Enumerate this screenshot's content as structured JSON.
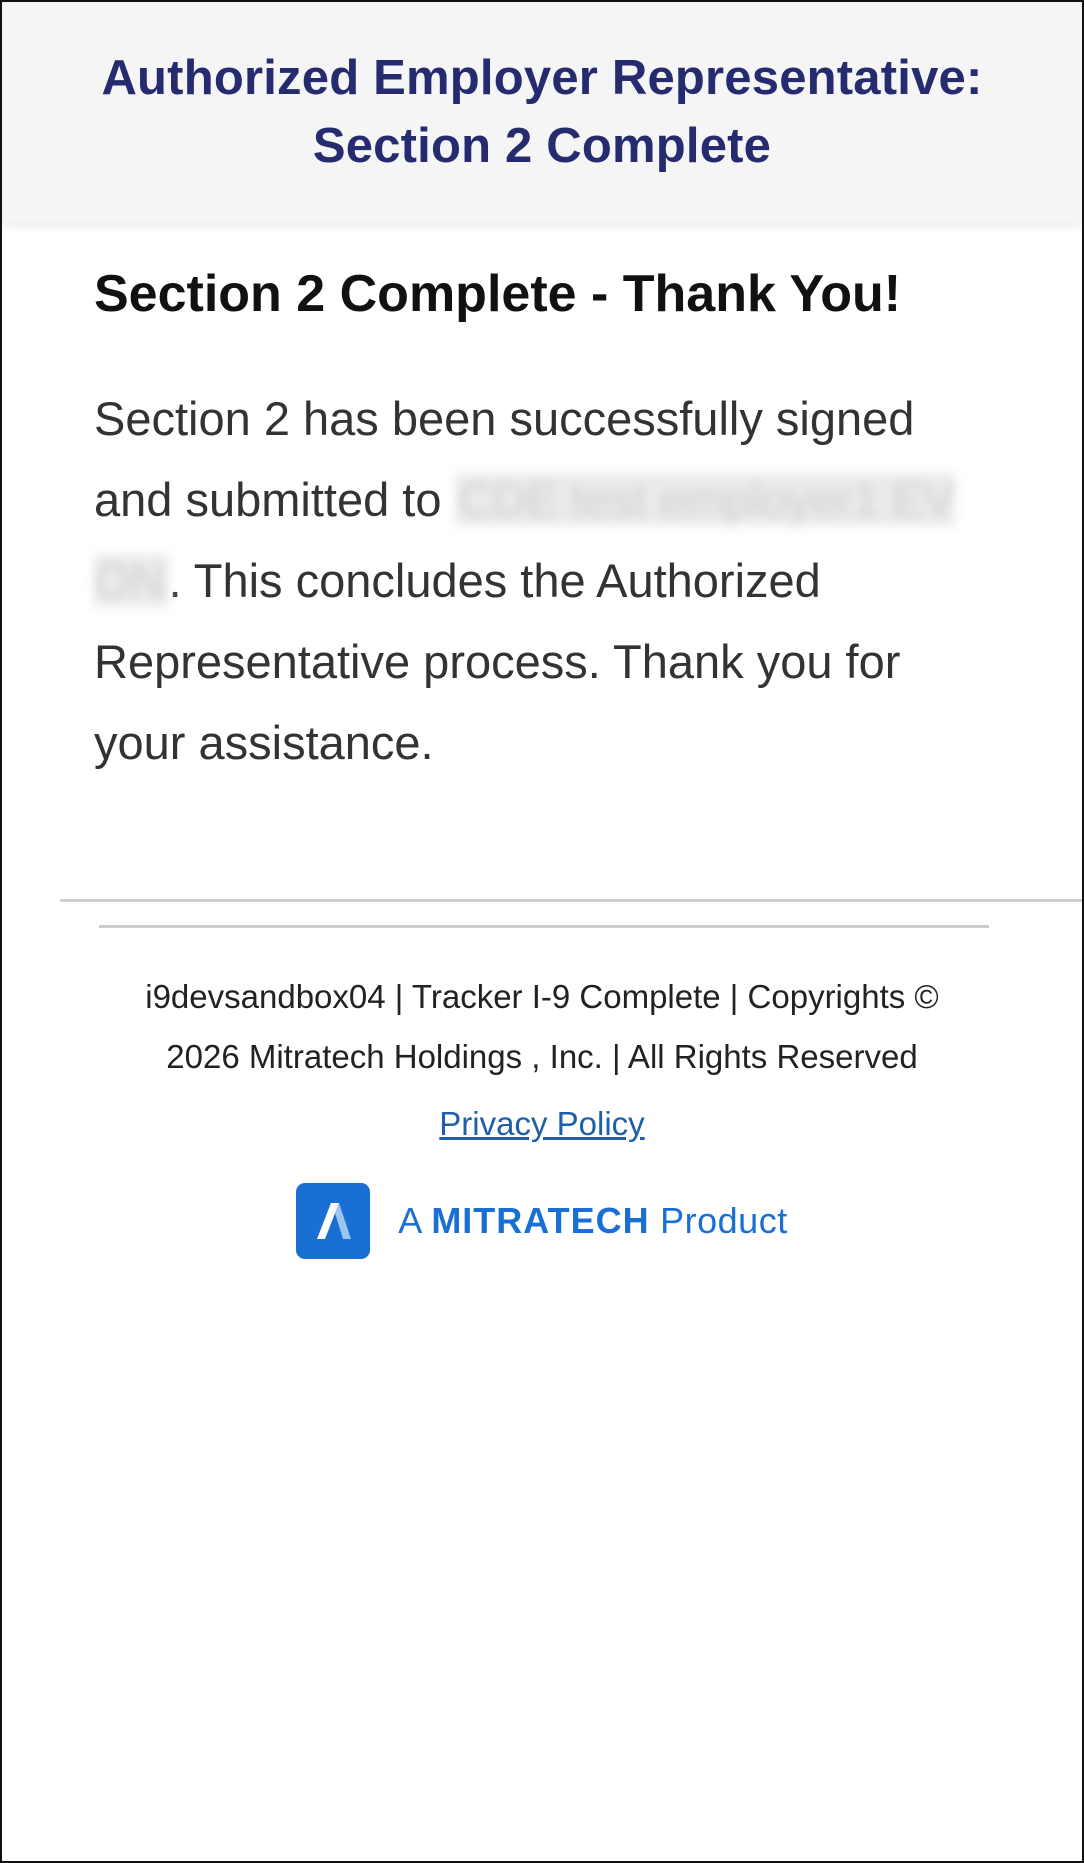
{
  "header": {
    "title_line1": "Authorized Employer Representative:",
    "title_line2": "Section 2 Complete"
  },
  "main": {
    "heading": "Section 2 Complete - Thank You!",
    "message_part1": "Section 2 has been successfully signed and submitted to ",
    "employer_name_redacted": "CDE test employer1 EV ON",
    "message_part2": ". This concludes the Authorized Representative process. Thank you for your assistance."
  },
  "footer": {
    "text_line1": "i9devsandbox04 | Tracker I-9 Complete | Copyrights ©",
    "text_line2": "2026 Mitratech Holdings , Inc. | All Rights Reserved",
    "privacy_link": "Privacy Policy",
    "brand_prefix": "A ",
    "brand_name": "MITRATECH",
    "brand_suffix": " Product",
    "brand_icon": "mitratech-logo-icon"
  },
  "colors": {
    "header_bg": "#f5f5f5",
    "title": "#252b6e",
    "link": "#1f5fa8",
    "brand": "#1a6fd4"
  }
}
